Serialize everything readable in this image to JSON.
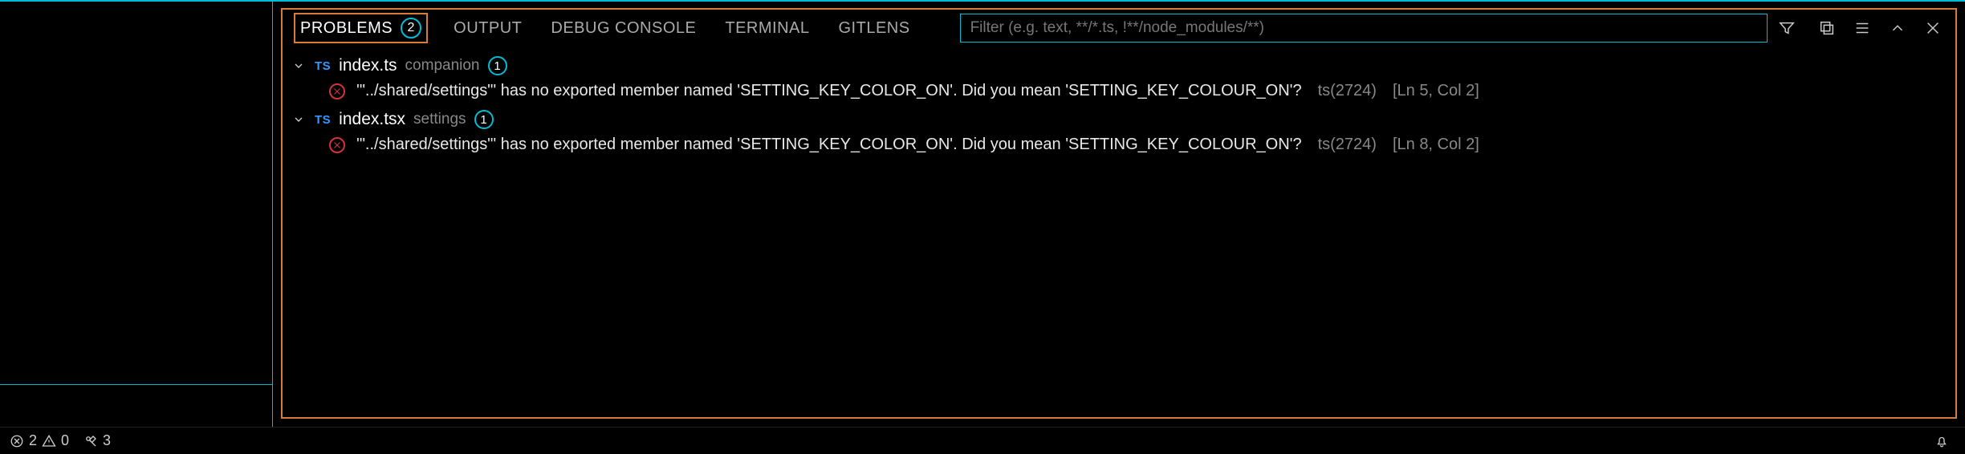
{
  "tabs": {
    "problems": "PROBLEMS",
    "problems_count": "2",
    "output": "OUTPUT",
    "debug_console": "DEBUG CONSOLE",
    "terminal": "TERMINAL",
    "gitlens": "GITLENS"
  },
  "filter": {
    "placeholder": "Filter (e.g. text, **/*.ts, !**/node_modules/**)"
  },
  "problems": [
    {
      "lang_badge": "TS",
      "file": "index.ts",
      "path": "companion",
      "count": "1",
      "errors": [
        {
          "message": "'\"../shared/settings\"' has no exported member named 'SETTING_KEY_COLOR_ON'. Did you mean 'SETTING_KEY_COLOUR_ON'?",
          "code": "ts(2724)",
          "location": "[Ln 5, Col 2]"
        }
      ]
    },
    {
      "lang_badge": "TS",
      "file": "index.tsx",
      "path": "settings",
      "count": "1",
      "errors": [
        {
          "message": "'\"../shared/settings\"' has no exported member named 'SETTING_KEY_COLOR_ON'. Did you mean 'SETTING_KEY_COLOUR_ON'?",
          "code": "ts(2724)",
          "location": "[Ln 8, Col 2]"
        }
      ]
    }
  ],
  "statusbar": {
    "errors": "2",
    "warnings": "0",
    "tools": "3"
  }
}
